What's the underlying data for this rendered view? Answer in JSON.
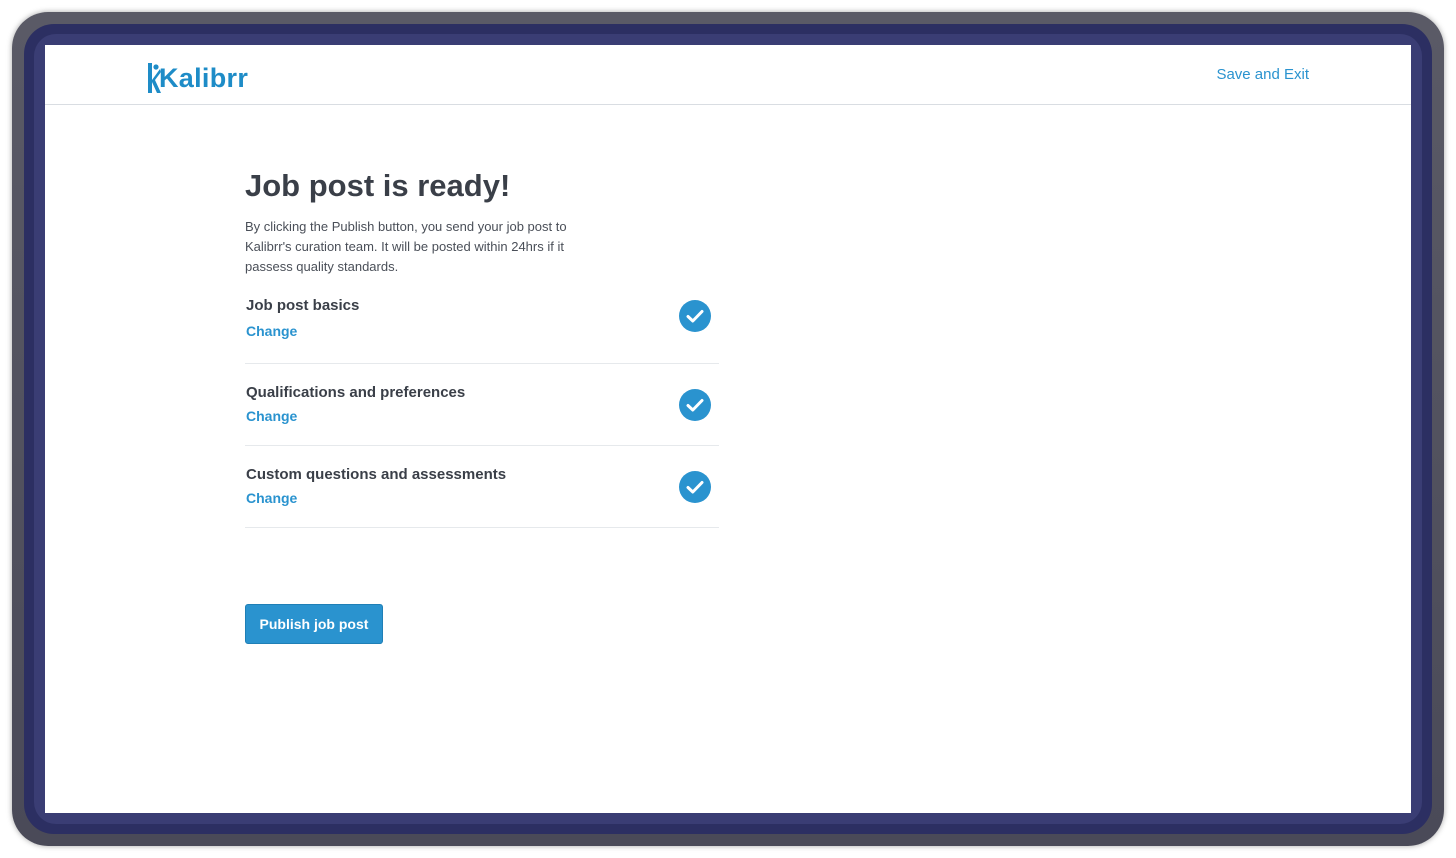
{
  "header": {
    "logo_text": "Kalibrr",
    "save_exit_label": "Save and Exit"
  },
  "main": {
    "title": "Job post is ready!",
    "description": "By clicking the Publish button, you send your job post to Kalibrr's curation team. It will be posted within 24hrs if it passess quality standards.",
    "steps": [
      {
        "title": "Job post basics",
        "change_label": "Change",
        "status": "complete",
        "icon": "check-circle-icon"
      },
      {
        "title": "Qualifications and preferences",
        "change_label": "Change",
        "status": "complete",
        "icon": "check-circle-icon"
      },
      {
        "title": "Custom questions and assessments",
        "change_label": "Change",
        "status": "complete",
        "icon": "check-circle-icon"
      }
    ],
    "publish_label": "Publish job post"
  },
  "colors": {
    "accent": "#2a93cf",
    "brand": "#1e8cc7",
    "text": "#3a3f48"
  }
}
